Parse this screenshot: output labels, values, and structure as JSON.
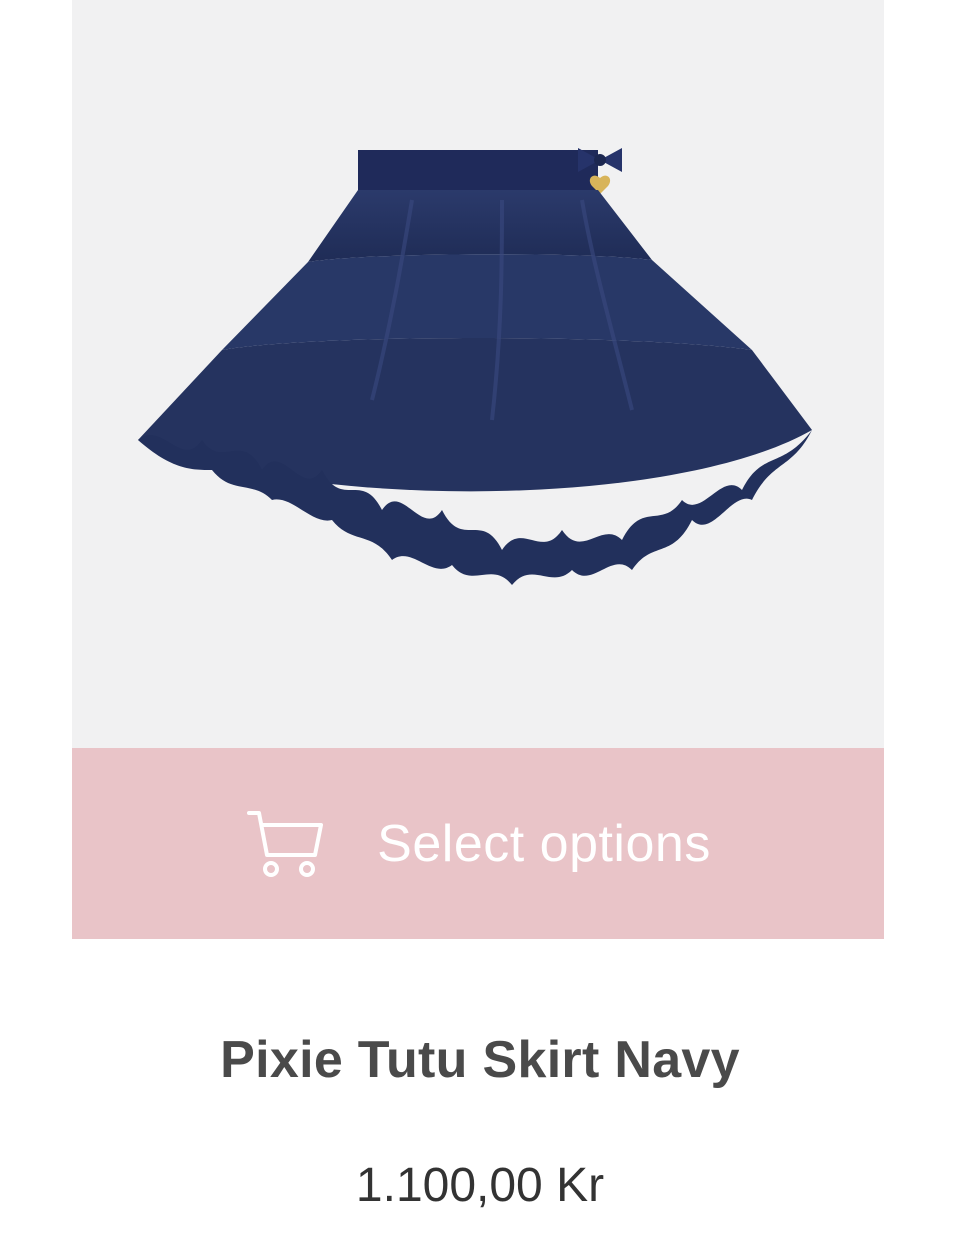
{
  "product": {
    "image_icon": "navy-tutu-skirt-photo",
    "cta": {
      "icon": "shopping-cart-icon",
      "label": "Select options",
      "background_color": "#e9c4c8",
      "text_color": "#ffffff"
    },
    "title": "Pixie Tutu Skirt Navy",
    "price": "1.100,00 Kr",
    "skirt_color": "#283867"
  }
}
